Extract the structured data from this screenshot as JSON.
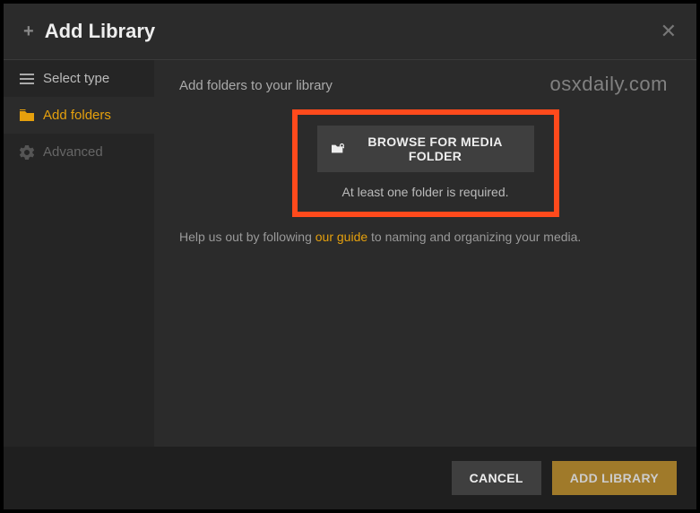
{
  "header": {
    "title": "Add Library"
  },
  "sidebar": {
    "items": [
      {
        "label": "Select type"
      },
      {
        "label": "Add folders"
      },
      {
        "label": "Advanced"
      }
    ]
  },
  "main": {
    "heading": "Add folders to your library",
    "watermark": "osxdaily.com",
    "browse_button": "BROWSE FOR MEDIA FOLDER",
    "required_text": "At least one folder is required.",
    "help_prefix": "Help us out by following ",
    "help_link": "our guide",
    "help_suffix": " to naming and organizing your media."
  },
  "footer": {
    "cancel": "CANCEL",
    "add": "ADD LIBRARY"
  }
}
